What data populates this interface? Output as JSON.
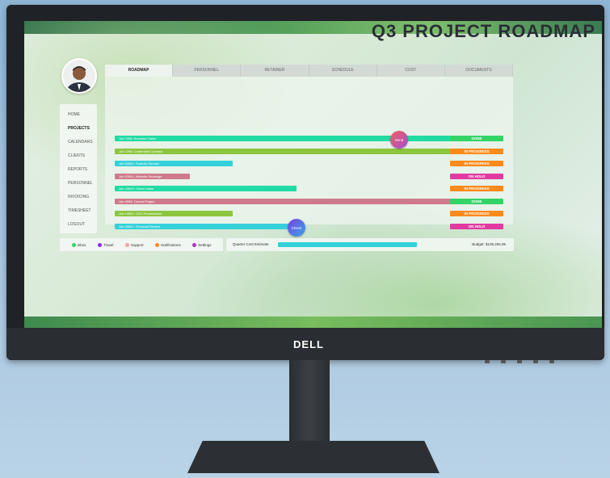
{
  "app": {
    "title": "Q3 PROJECT ROADMAP",
    "monitor_brand": "DELL"
  },
  "tabs": [
    "ROADMAP",
    "PERSONNEL",
    "RETAINER",
    "SCHEDULE",
    "COST",
    "DOCUMENTS"
  ],
  "active_tab": "ROADMAP",
  "sidebar": {
    "items": [
      "HOME",
      "PROJECTS",
      "CALENDARS",
      "CLIENTS",
      "REPORTS",
      "PERSONNEL",
      "INVOICING",
      "TIMESHEET",
      "LOGOUT"
    ],
    "active": "PROJECTS"
  },
  "jobs": [
    {
      "label": "Job 7358: Recruiter Sales",
      "status": "DONE",
      "color": "#20dba3",
      "status_color": "#33d466",
      "progress": 1.0
    },
    {
      "label": "Job 7255: Contentrail Contract",
      "status": "IN PROGRESS",
      "color": "#8cc63f",
      "status_color": "#ff8a1a",
      "progress": 1.0
    },
    {
      "label": "Job 53581: Portfolio Review",
      "status": "IN PROGRESS",
      "color": "#35d1da",
      "status_color": "#ff8a1a",
      "progress": 0.33
    },
    {
      "label": "Job 53591: Website Redesign",
      "status": "ON HOLD",
      "color": "#cf7a8a",
      "status_color": "#e13aa0",
      "progress": 0.21
    },
    {
      "label": "Job 23599: Client Intake",
      "status": "IN PROGRESS",
      "color": "#20dba3",
      "status_color": "#ff8a1a",
      "progress": 0.51
    },
    {
      "label": "Job 4958: Tutorial Pages",
      "status": "DONE",
      "color": "#cf7a8a",
      "status_color": "#33d466",
      "progress": 1.0
    },
    {
      "label": "Job 19591: CEO Presentation",
      "status": "IN PROGRESS",
      "color": "#8cc63f",
      "status_color": "#ff8a1a",
      "progress": 0.33
    },
    {
      "label": "Job 39591: Financial Review",
      "status": "ON HOLD",
      "color": "#35d1da",
      "status_color": "#e13aa0",
      "progress": 0.51
    }
  ],
  "pins": [
    {
      "label": "Send",
      "colors": [
        "#f25f5c",
        "#a24fd1"
      ]
    },
    {
      "label": "Check",
      "colors": [
        "#7b3fe0",
        "#35a7e8"
      ]
    }
  ],
  "legend": [
    {
      "label": "Inbox",
      "color": "#33d466"
    },
    {
      "label": "Travel",
      "color": "#8a2be2"
    },
    {
      "label": "Support",
      "color": "#f2a3a3"
    },
    {
      "label": "Notifications",
      "color": "#ff8a1a"
    },
    {
      "label": "Settings",
      "color": "#b030c8"
    }
  ],
  "cost": {
    "label": "Quarter Cost Estimate",
    "progress": 1.0,
    "budget": "Budget: $105,256.85"
  }
}
